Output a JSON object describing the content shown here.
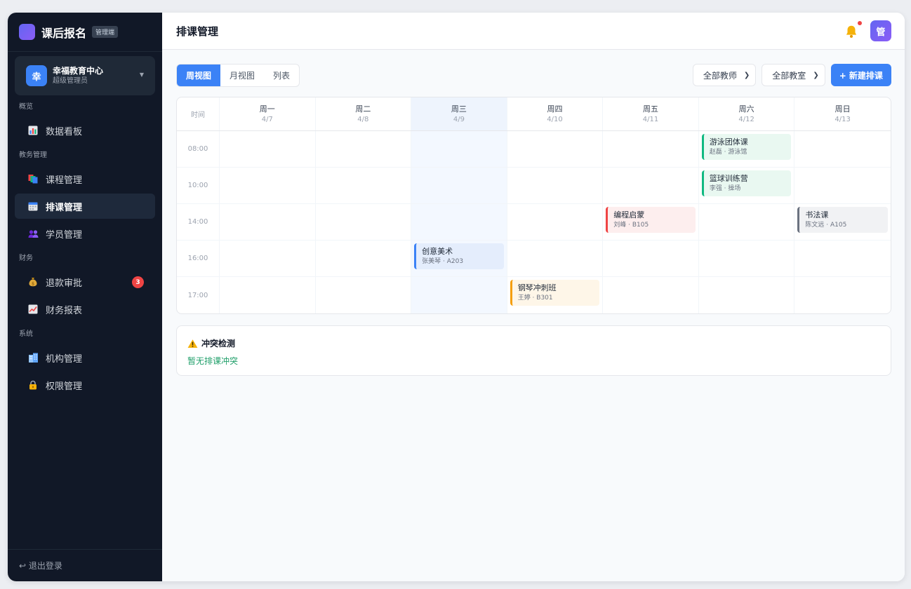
{
  "app": {
    "name": "课后报名",
    "tag": "管理端",
    "brand_color": "#6366f1"
  },
  "org": {
    "avatar": "幸",
    "name": "幸福教育中心",
    "role": "超级管理员"
  },
  "nav": {
    "sections": [
      {
        "label": "概览",
        "items": [
          {
            "id": "dashboard",
            "label": "数据看板",
            "icon": "chart-icon"
          }
        ]
      },
      {
        "label": "教务管理",
        "items": [
          {
            "id": "courses",
            "label": "课程管理",
            "icon": "books-icon"
          },
          {
            "id": "schedule",
            "label": "排课管理",
            "icon": "calendar-icon",
            "active": true
          },
          {
            "id": "students",
            "label": "学员管理",
            "icon": "users-icon"
          }
        ]
      },
      {
        "label": "财务",
        "items": [
          {
            "id": "refund",
            "label": "退款审批",
            "icon": "money-bag-icon",
            "badge": "3"
          },
          {
            "id": "reports",
            "label": "财务报表",
            "icon": "trend-icon"
          }
        ]
      },
      {
        "label": "系统",
        "items": [
          {
            "id": "orgs",
            "label": "机构管理",
            "icon": "building-icon"
          },
          {
            "id": "perms",
            "label": "权限管理",
            "icon": "lock-icon"
          }
        ]
      }
    ],
    "logout": "↩ 退出登录"
  },
  "header": {
    "title": "排课管理",
    "user_avatar": "管"
  },
  "toolbar": {
    "views": [
      "周视图",
      "月视图",
      "列表"
    ],
    "active_view": 0,
    "teacher_select": "全部教师",
    "room_select": "全部教室",
    "new_button": "+ 新建排课"
  },
  "calendar": {
    "time_header": "时间",
    "today_index": 2,
    "days": [
      {
        "name": "周一",
        "date": "4/7"
      },
      {
        "name": "周二",
        "date": "4/8"
      },
      {
        "name": "周三",
        "date": "4/9"
      },
      {
        "name": "周四",
        "date": "4/10"
      },
      {
        "name": "周五",
        "date": "4/11"
      },
      {
        "name": "周六",
        "date": "4/12"
      },
      {
        "name": "周日",
        "date": "4/13"
      }
    ],
    "slots": [
      "08:00",
      "10:00",
      "14:00",
      "16:00",
      "17:00"
    ],
    "events": [
      {
        "slot": 0,
        "day": 5,
        "title": "游泳团体课",
        "meta": "赵磊 · 游泳馆",
        "color": "#10b981",
        "bg": "#e9f8f1"
      },
      {
        "slot": 1,
        "day": 5,
        "title": "篮球训练营",
        "meta": "李强 · 操场",
        "color": "#10b981",
        "bg": "#e9f8f1"
      },
      {
        "slot": 2,
        "day": 4,
        "title": "编程启蒙",
        "meta": "刘峰 · B105",
        "color": "#ef4444",
        "bg": "#fdeeee"
      },
      {
        "slot": 2,
        "day": 6,
        "title": "书法课",
        "meta": "陈文远 · A105",
        "color": "#6b7280",
        "bg": "#f1f2f4"
      },
      {
        "slot": 3,
        "day": 2,
        "title": "创意美术",
        "meta": "张美琴 · A203",
        "color": "#3b82f6",
        "bg": "#e4edfc"
      },
      {
        "slot": 4,
        "day": 3,
        "title": "钢琴冲刺班",
        "meta": "王婷 · B301",
        "color": "#f59e0b",
        "bg": "#fef6e8"
      }
    ]
  },
  "conflict": {
    "title": "冲突检测",
    "status": "暂无排课冲突"
  }
}
